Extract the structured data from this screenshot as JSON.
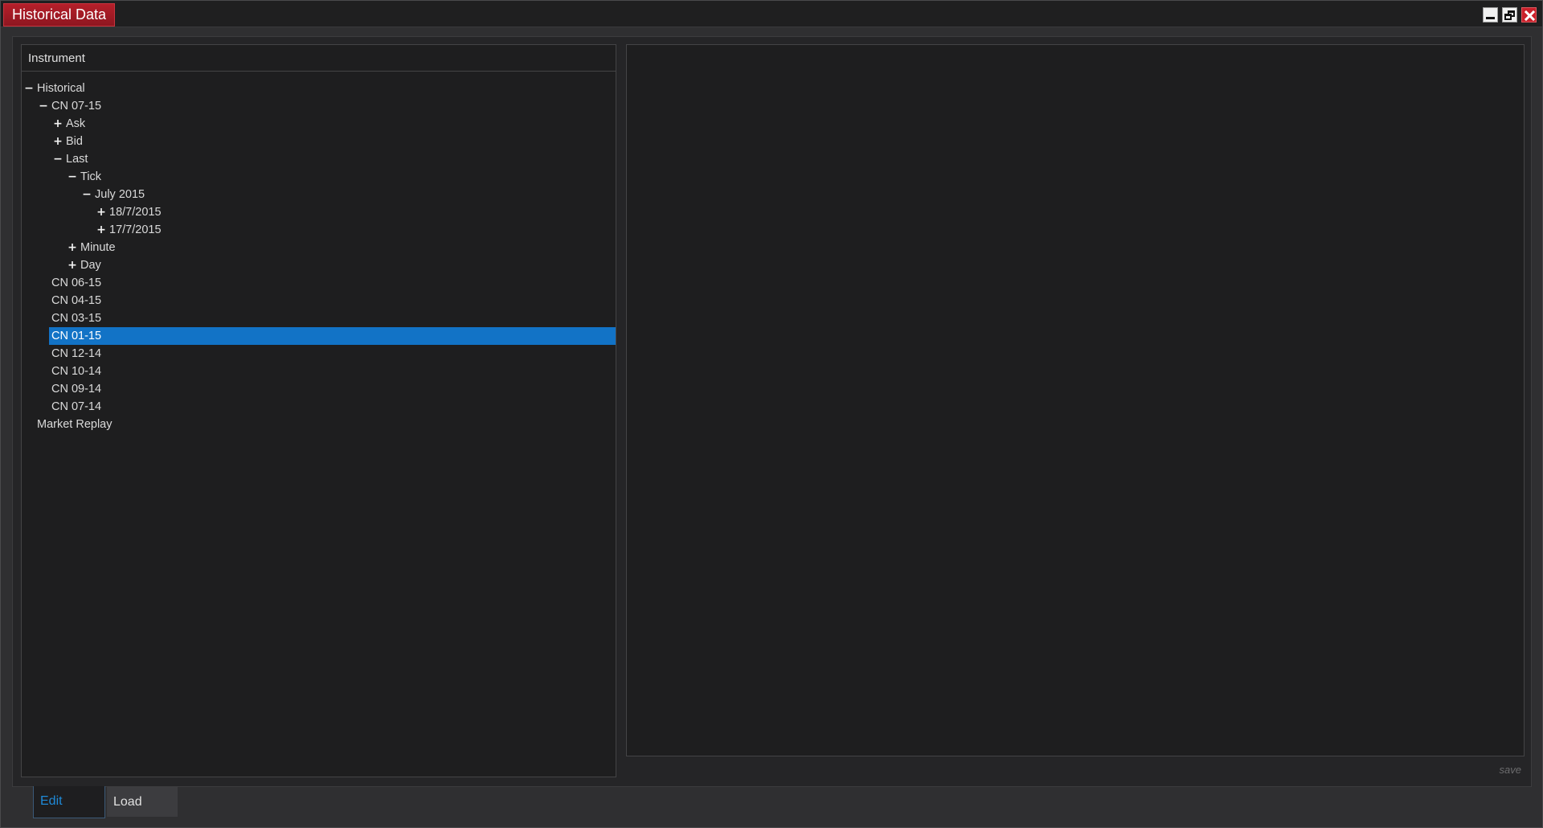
{
  "window": {
    "title": "Historical Data",
    "controls": [
      "minimize-icon",
      "restore-icon",
      "close-icon"
    ]
  },
  "tree": {
    "header": "Instrument",
    "nodes": [
      {
        "label": "Historical",
        "toggle": "−",
        "depth": 0
      },
      {
        "label": "CN 07-15",
        "toggle": "−",
        "depth": 1
      },
      {
        "label": "Ask",
        "toggle": "+",
        "depth": 2
      },
      {
        "label": "Bid",
        "toggle": "+",
        "depth": 2
      },
      {
        "label": "Last",
        "toggle": "−",
        "depth": 2
      },
      {
        "label": "Tick",
        "toggle": "−",
        "depth": 3
      },
      {
        "label": "July 2015",
        "toggle": "−",
        "depth": 4
      },
      {
        "label": "18/7/2015",
        "toggle": "+",
        "depth": 5
      },
      {
        "label": "17/7/2015",
        "toggle": "+",
        "depth": 5
      },
      {
        "label": "Minute",
        "toggle": "+",
        "depth": 3
      },
      {
        "label": "Day",
        "toggle": "+",
        "depth": 3
      },
      {
        "label": "CN 06-15",
        "toggle": "",
        "depth": 1
      },
      {
        "label": "CN 04-15",
        "toggle": "",
        "depth": 1
      },
      {
        "label": "CN 03-15",
        "toggle": "",
        "depth": 1
      },
      {
        "label": "CN 01-15",
        "toggle": "",
        "depth": 1,
        "selected": true
      },
      {
        "label": "CN 12-14",
        "toggle": "",
        "depth": 1
      },
      {
        "label": "CN 10-14",
        "toggle": "",
        "depth": 1
      },
      {
        "label": "CN 09-14",
        "toggle": "",
        "depth": 1
      },
      {
        "label": "CN 07-14",
        "toggle": "",
        "depth": 1
      },
      {
        "label": "Market Replay",
        "toggle": "",
        "depth": 0
      }
    ]
  },
  "right_panel": {
    "save_label": "save"
  },
  "tabs": {
    "edit": "Edit",
    "load": "Load",
    "active": "Edit"
  },
  "colors": {
    "title_accent": "#b51f2a",
    "selection": "#1273c6",
    "active_tab_text": "#1f8ad8"
  }
}
